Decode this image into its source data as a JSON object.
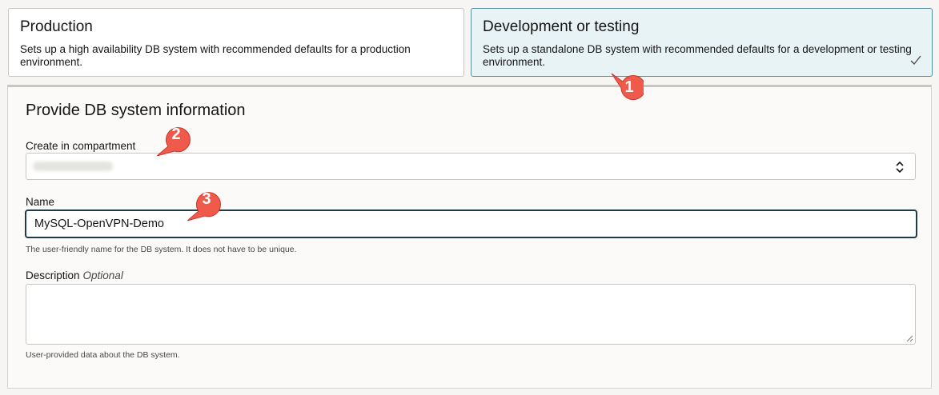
{
  "cards": {
    "production": {
      "title": "Production",
      "description": "Sets up a high availability DB system with recommended defaults for a production environment."
    },
    "development": {
      "title": "Development or testing",
      "description": "Sets up a standalone DB system with recommended defaults for a development or testing environment."
    }
  },
  "form": {
    "title": "Provide DB system information",
    "compartment": {
      "label": "Create in compartment"
    },
    "name": {
      "label": "Name",
      "value": "MySQL-OpenVPN-Demo",
      "help": "The user-friendly name for the DB system. It does not have to be unique."
    },
    "description": {
      "label": "Description",
      "optional": "Optional",
      "help": "User-provided data about the DB system."
    }
  },
  "annotations": [
    "1",
    "2",
    "3"
  ],
  "colors": {
    "selected_bg": "#e8f3f6",
    "callout": "#f05a4a",
    "focus_border": "#1d3c4c"
  }
}
